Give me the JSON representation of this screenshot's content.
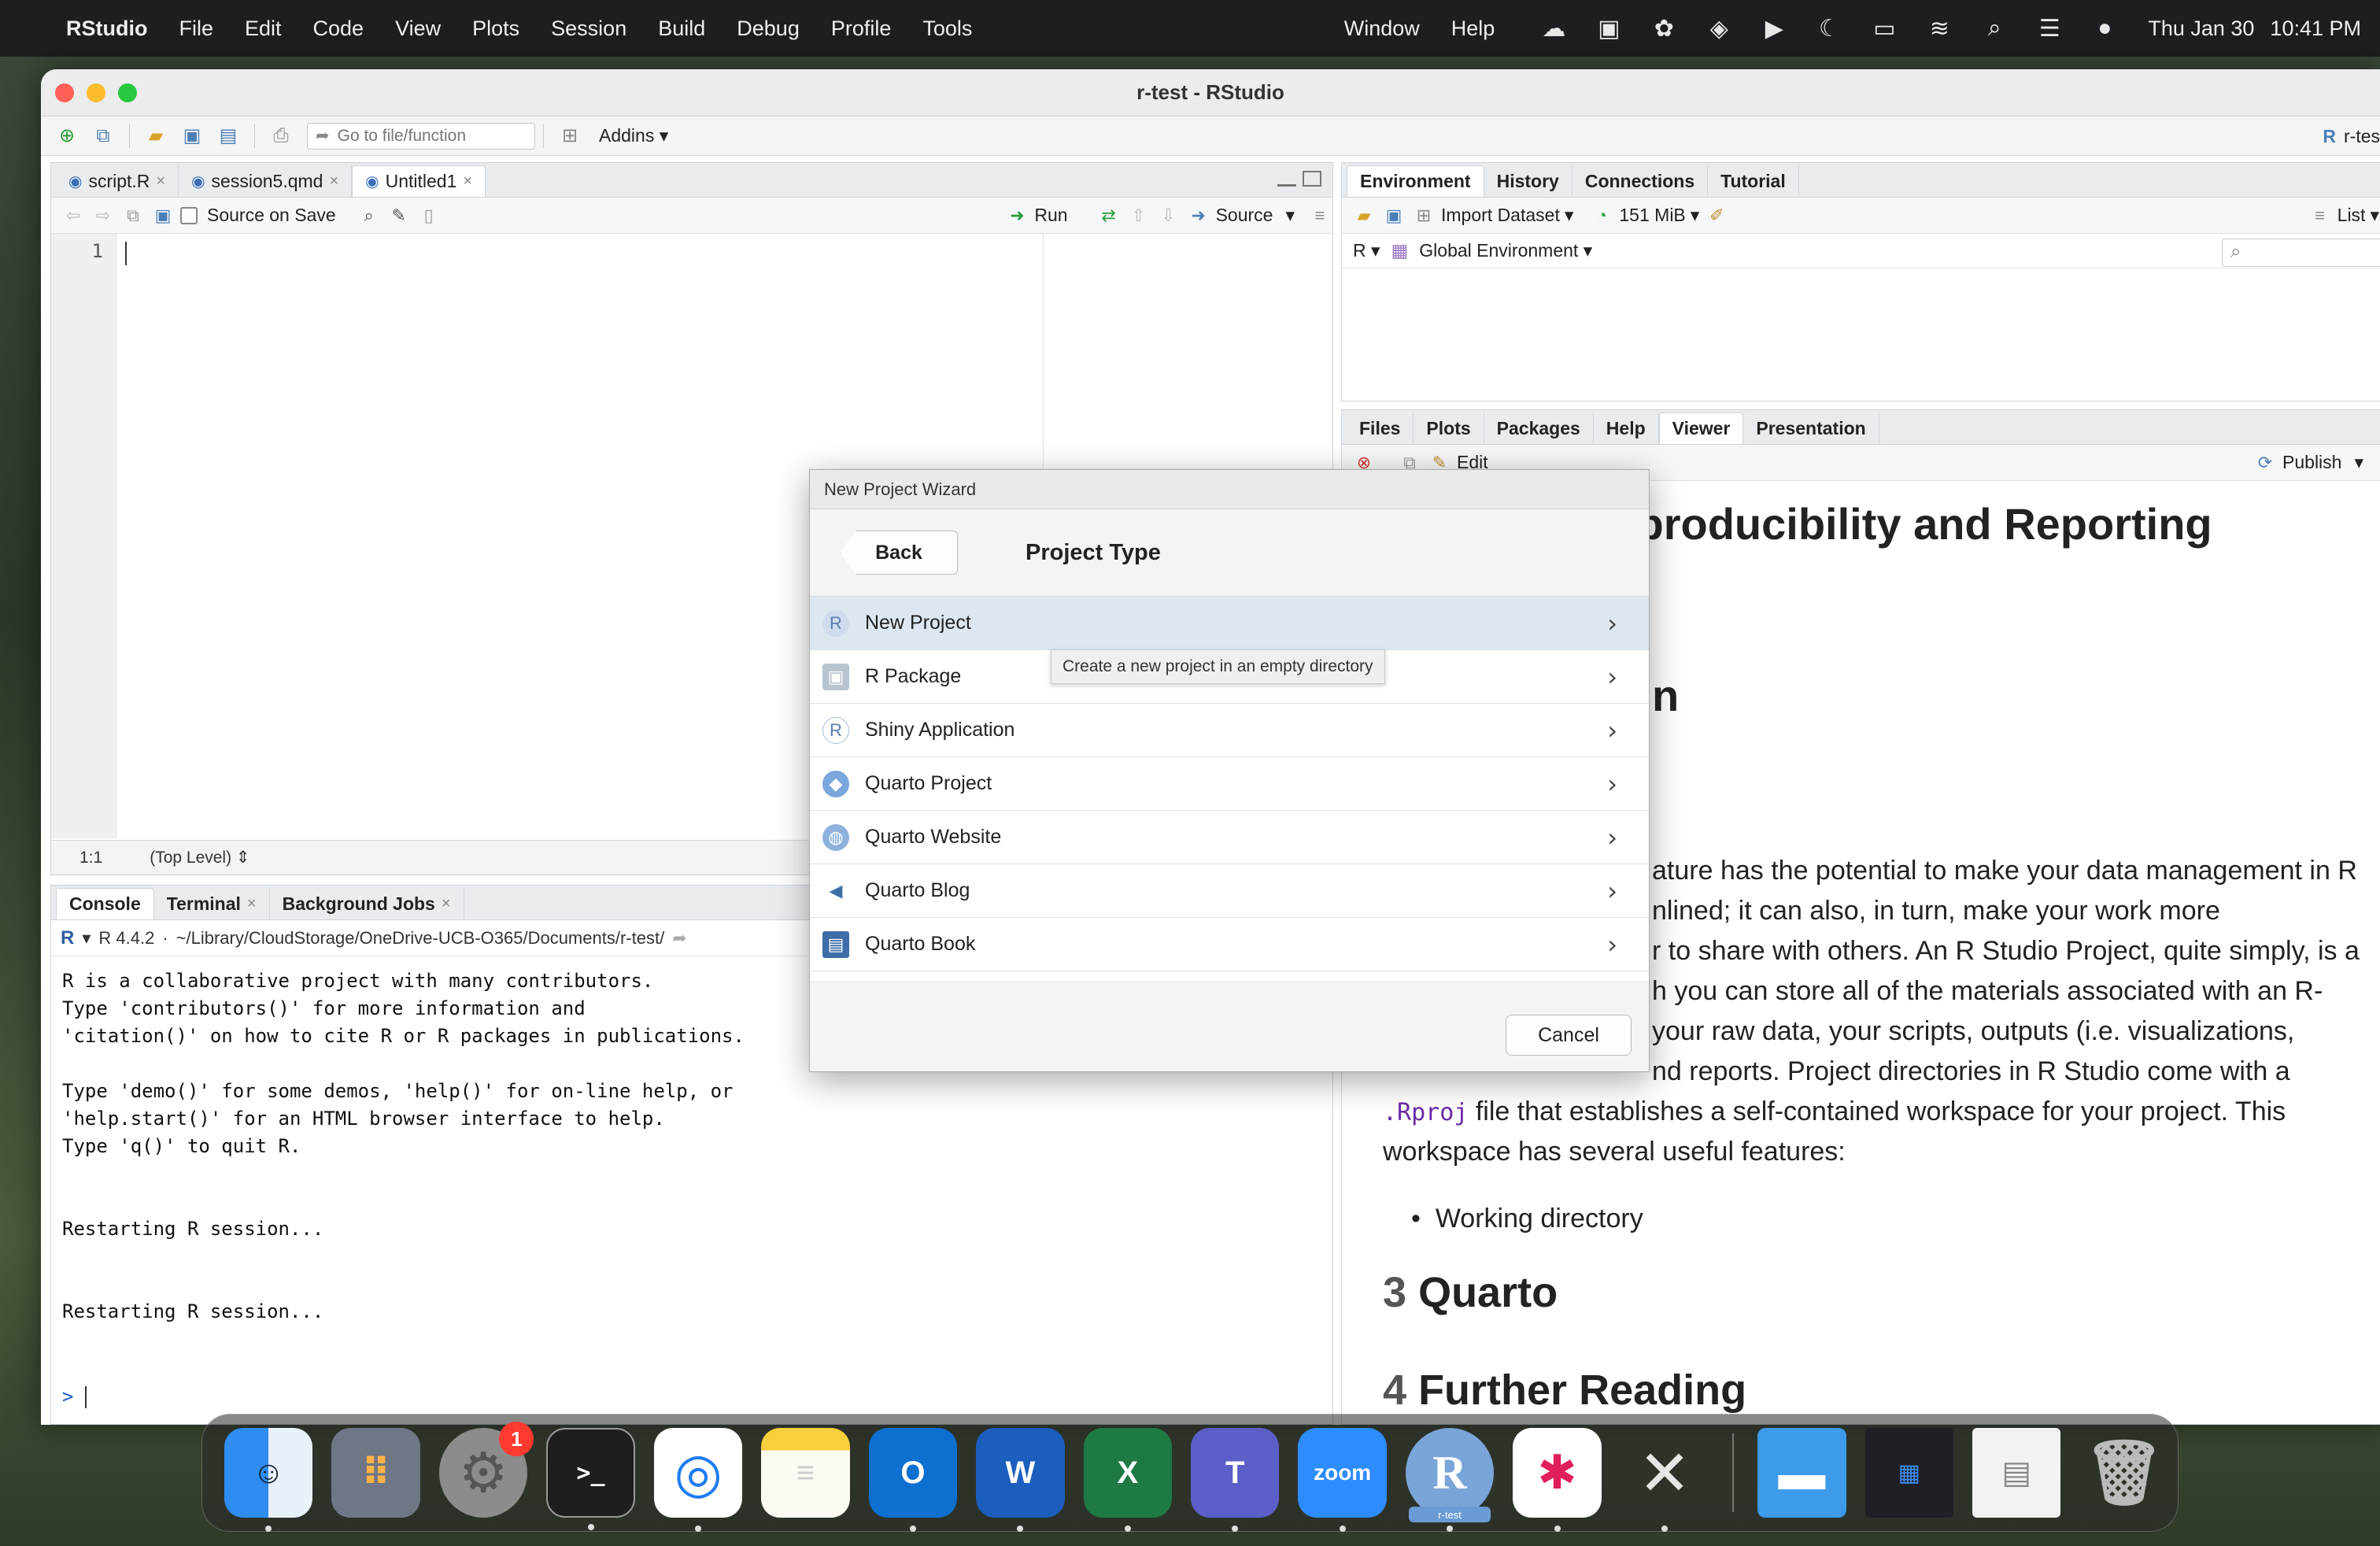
{
  "menubar": {
    "app_name": "RStudio",
    "menus": [
      "File",
      "Edit",
      "Code",
      "View",
      "Plots",
      "Session",
      "Build",
      "Debug",
      "Profile",
      "Tools"
    ],
    "right_menus": [
      "Window",
      "Help"
    ],
    "clock_date": "Thu Jan 30",
    "clock_time": "10:41 PM"
  },
  "window": {
    "title": "r-test - RStudio",
    "project_label": "r-tes"
  },
  "toolbar": {
    "goto_placeholder": "Go to file/function",
    "addins_label": "Addins"
  },
  "editor": {
    "tabs": [
      "script.R",
      "session5.qmd",
      "Untitled1"
    ],
    "source_on_save": "Source on Save",
    "run_label": "Run",
    "source_label": "Source",
    "line_number": "1",
    "cursor_pos": "1:1",
    "scope": "(Top Level)"
  },
  "console": {
    "tabs": [
      "Console",
      "Terminal",
      "Background Jobs"
    ],
    "r_version": "R 4.4.2",
    "path": "~/Library/CloudStorage/OneDrive-UCB-O365/Documents/r-test/",
    "output": "R is a collaborative project with many contributors.\nType 'contributors()' for more information and\n'citation()' on how to cite R or R packages in publications.\n\nType 'demo()' for some demos, 'help()' for on-line help, or\n'help.start()' for an HTML browser interface to help.\nType 'q()' to quit R.\n\n\nRestarting R session...\n\n\nRestarting R session...",
    "prompt": ">"
  },
  "environment": {
    "tabs": [
      "Environment",
      "History",
      "Connections",
      "Tutorial"
    ],
    "import_dataset": "Import Dataset",
    "memory": "151 MiB",
    "list_label": "List",
    "r_label": "R",
    "global_env": "Global Environment"
  },
  "files_pane": {
    "tabs": [
      "Files",
      "Plots",
      "Packages",
      "Help",
      "Viewer",
      "Presentation"
    ],
    "edit_label": "Edit",
    "publish_label": "Publish"
  },
  "viewer": {
    "heading": "Tools for Reproducibility and Reporting",
    "frag_n": "n",
    "para_lines": [
      "ature has the potential to make your data management in R",
      "nlined; it can also, in turn, make your work more",
      "r to share with others. An R Studio Project, quite simply, is a",
      "h you can store all of the materials associated with an R-",
      "your raw data, your scripts, outputs (i.e. visualizations,",
      "nd reports. Project directories in R Studio come with a"
    ],
    "rproj_code": ".Rproj",
    "rproj_rest": " file that establishes a self-contained workspace for your project. This",
    "workspace_line": "workspace has several useful features:",
    "bullet": "Working directory",
    "h_quarto_num": "3",
    "h_quarto": "Quarto",
    "h_further_num": "4",
    "h_further": "Further Reading"
  },
  "dialog": {
    "title": "New Project Wizard",
    "back_label": "Back",
    "heading": "Project Type",
    "items": [
      "New Project",
      "R Package",
      "Shiny Application",
      "Quarto Project",
      "Quarto Website",
      "Quarto Blog",
      "Quarto Book"
    ],
    "tooltip": "Create a new project in an empty directory",
    "cancel_label": "Cancel"
  },
  "dock": {
    "settings_badge": "1",
    "zoom_label": "zoom",
    "rstudio_label": "r-test"
  },
  "colors": {
    "accent": "#4a7fb8",
    "selection": "#dde7f2",
    "prompt": "#1d57c9",
    "badge": "#ff3b30"
  }
}
